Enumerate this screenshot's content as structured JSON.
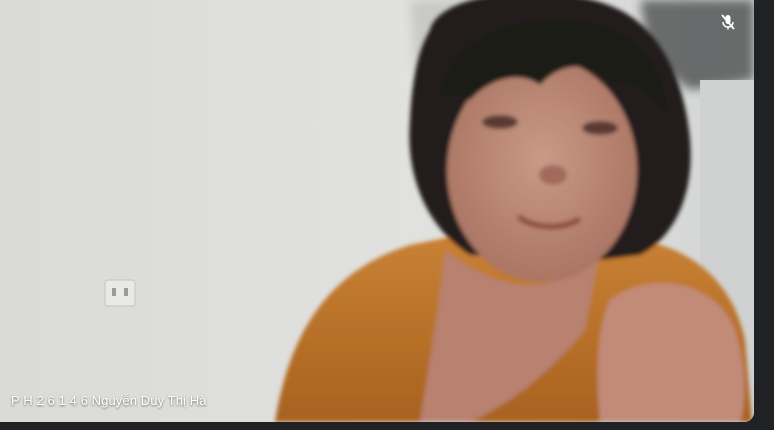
{
  "participant": {
    "name": "P H 2 6 1 4 6 Nguyễn Duy Thị Hà",
    "mic_muted": true
  },
  "icons": {
    "mic_status": "mic-off-icon"
  },
  "colors": {
    "background": "#202124",
    "name_text": "#ffffff",
    "shirt": "#b86f2a",
    "wall": "#dcdcda"
  }
}
